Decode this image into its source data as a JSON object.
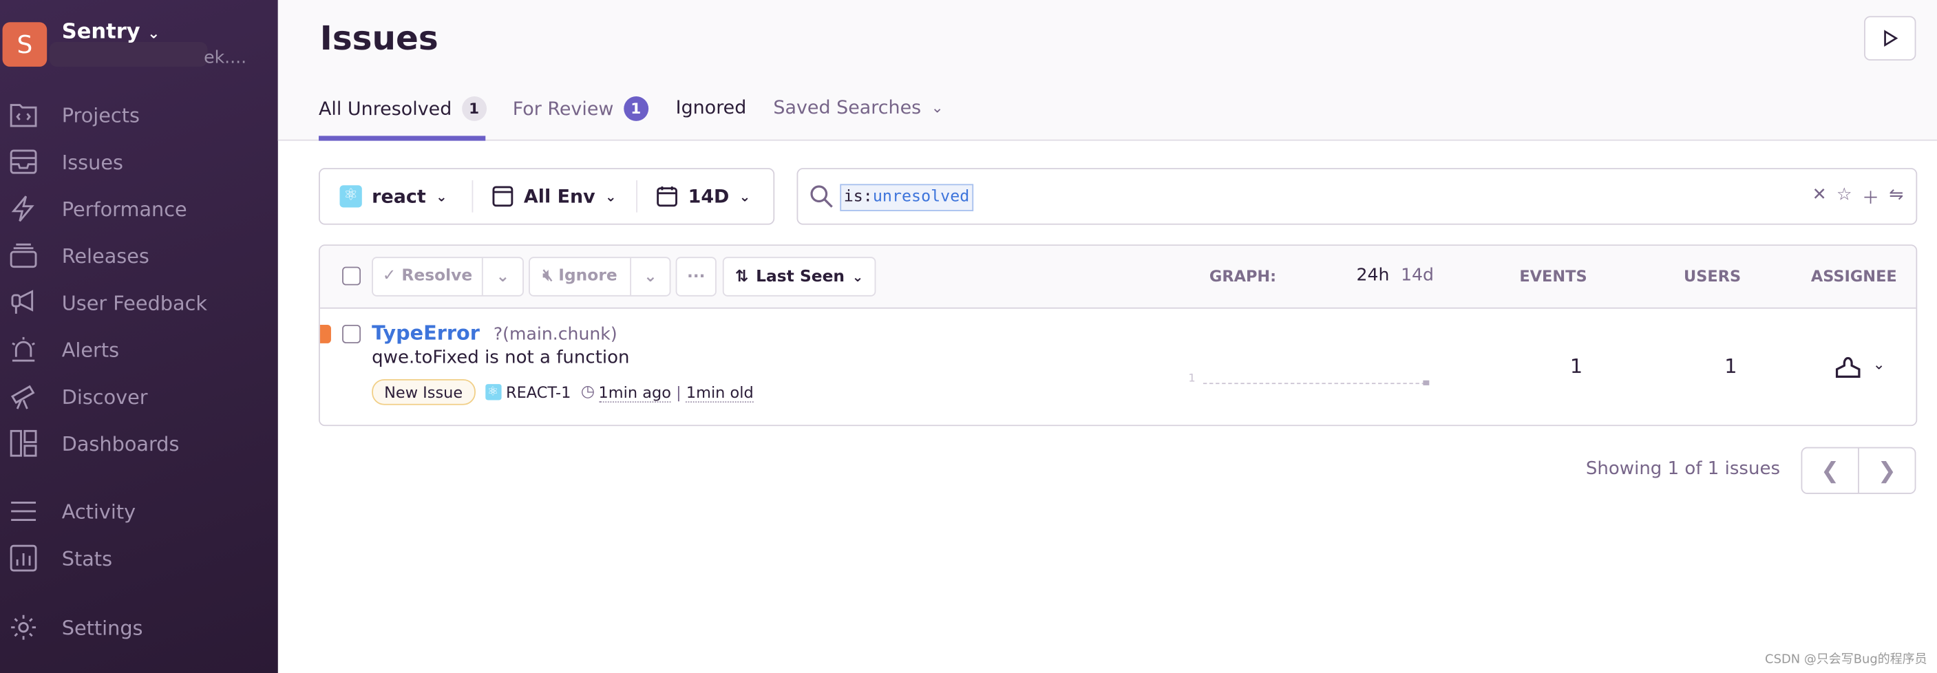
{
  "sidebar": {
    "org_initial": "S",
    "org_name": "Sentry",
    "org_sub": "ek....",
    "items": [
      {
        "label": "Projects",
        "icon": "folder-code-icon"
      },
      {
        "label": "Issues",
        "icon": "inbox-icon"
      },
      {
        "label": "Performance",
        "icon": "lightning-icon"
      },
      {
        "label": "Releases",
        "icon": "stack-icon"
      },
      {
        "label": "User Feedback",
        "icon": "megaphone-icon"
      },
      {
        "label": "Alerts",
        "icon": "siren-icon"
      },
      {
        "label": "Discover",
        "icon": "telescope-icon"
      },
      {
        "label": "Dashboards",
        "icon": "dashboard-icon"
      },
      {
        "label": "Activity",
        "icon": "list-icon"
      },
      {
        "label": "Stats",
        "icon": "bar-chart-icon"
      },
      {
        "label": "Settings",
        "icon": "gear-icon"
      }
    ]
  },
  "header": {
    "title": "Issues",
    "tabs": [
      {
        "label": "All Unresolved",
        "count": "1"
      },
      {
        "label": "For Review",
        "count": "1"
      },
      {
        "label": "Ignored"
      },
      {
        "label": "Saved Searches"
      }
    ]
  },
  "filters": {
    "project": "react",
    "environment": "All Env",
    "period": "14D"
  },
  "search": {
    "key": "is:",
    "value": "unresolved"
  },
  "toolbar": {
    "resolve": "Resolve",
    "ignore": "Ignore",
    "more": "···",
    "sort": "Last Seen",
    "graph_label": "GRAPH:",
    "graph_24h": "24h",
    "graph_14d": "14d",
    "events": "EVENTS",
    "users": "USERS",
    "assignee": "ASSIGNEE"
  },
  "issues": [
    {
      "title": "TypeError",
      "culprit": "?(main.chunk)",
      "message": "qwe.toFixed is not a function",
      "badge": "New Issue",
      "short_id": "REACT-1",
      "last_seen": "1min ago",
      "age": "1min old",
      "graph_max": "1",
      "events": "1",
      "users": "1"
    }
  ],
  "pagination": {
    "summary": "Showing 1 of 1 issues"
  },
  "colors": {
    "accent": "#6c5fc7",
    "link": "#3d74db",
    "level_error": "#f17e3f",
    "sidebar": "#3f2850"
  },
  "watermark": "CSDN @只会写Bug的程序员"
}
